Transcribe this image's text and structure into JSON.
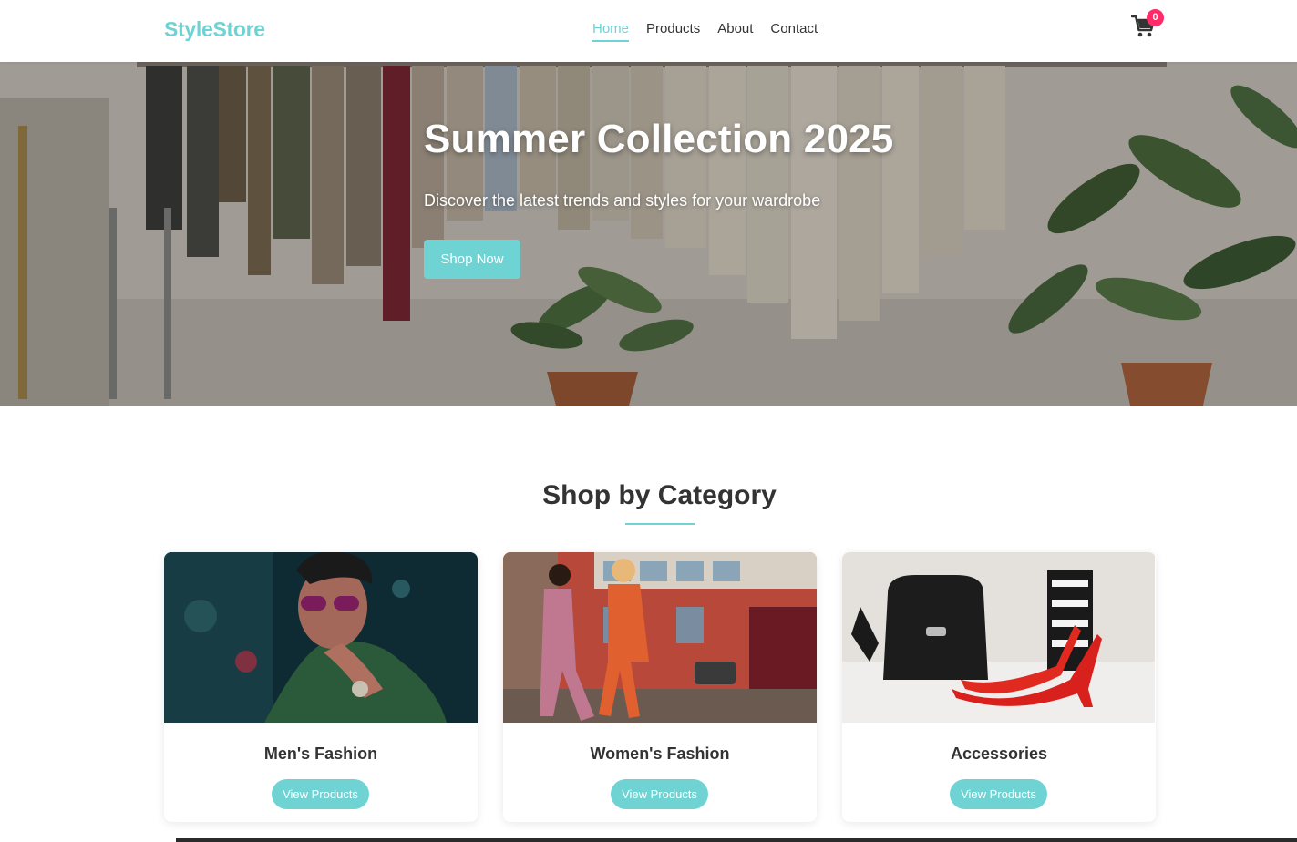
{
  "header": {
    "logo": "StyleStore",
    "nav": [
      {
        "label": "Home",
        "active": true
      },
      {
        "label": "Products",
        "active": false
      },
      {
        "label": "About",
        "active": false
      },
      {
        "label": "Contact",
        "active": false
      }
    ],
    "cart_icon": "shopping-cart-icon",
    "cart_count": "0"
  },
  "hero": {
    "title": "Summer Collection 2025",
    "subtitle": "Discover the latest trends and styles for your wardrobe",
    "cta_label": "Shop Now"
  },
  "categories": {
    "title": "Shop by Category",
    "items": [
      {
        "name": "Men's Fashion",
        "button_label": "View Products"
      },
      {
        "name": "Women's Fashion",
        "button_label": "View Products"
      },
      {
        "name": "Accessories",
        "button_label": "View Products"
      }
    ]
  },
  "colors": {
    "accent": "#6fd3d3",
    "badge": "#ff2a68",
    "text": "#333333"
  }
}
